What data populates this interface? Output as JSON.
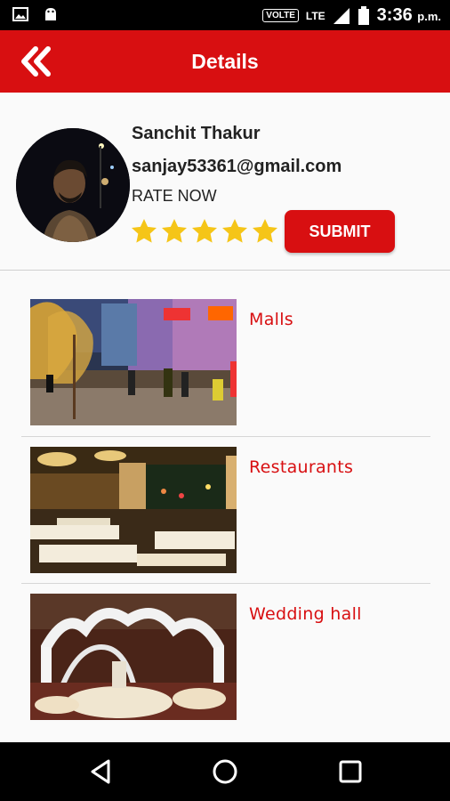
{
  "status_bar": {
    "icons": [
      "image-icon",
      "android-icon",
      "volte-badge",
      "lte-icon",
      "signal-icon",
      "battery-icon"
    ],
    "volte": "VOLTE",
    "lte": "LTE",
    "time": "3:36",
    "ampm": "p.m."
  },
  "header": {
    "title": "Details",
    "back_icon": "double-chevron-left-icon"
  },
  "profile": {
    "name": "Sanchit Thakur",
    "email": "sanjay53361@gmail.com",
    "rate_label": "RATE NOW",
    "rating": 5,
    "max_rating": 5,
    "submit_label": "SUBMIT"
  },
  "categories": [
    {
      "label": "Malls"
    },
    {
      "label": "Restaurants"
    },
    {
      "label": "Wedding hall"
    }
  ],
  "nav": {
    "icons": [
      "back-triangle-icon",
      "home-circle-icon",
      "recents-square-icon"
    ]
  },
  "colors": {
    "primary": "#d80f11",
    "star": "#f5c518",
    "status_bar": "#000000"
  }
}
